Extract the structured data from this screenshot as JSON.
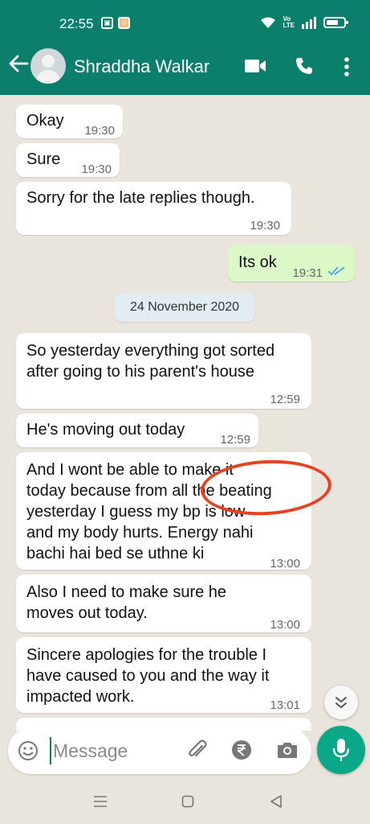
{
  "status_bar": {
    "time": "22:55",
    "notif_icons": [
      "image-icon",
      "avatar-notification-icon"
    ],
    "right_icons": [
      "wifi-icon",
      "volte-icon",
      "signal-icon",
      "battery-icon"
    ]
  },
  "header": {
    "contact_name": "Shraddha Walkar",
    "back_icon": "arrow-left-icon",
    "actions": [
      "video-call-icon",
      "phone-icon",
      "more-vert-icon"
    ],
    "bg_color": "#0b7e6c"
  },
  "messages": [
    {
      "direction": "in",
      "text": "Okay",
      "time": "19:30"
    },
    {
      "direction": "in",
      "text": "Sure",
      "time": "19:30"
    },
    {
      "direction": "in",
      "text": "Sorry for the late replies though.",
      "time": "19:30"
    },
    {
      "direction": "out",
      "text": "Its ok",
      "time": "19:31",
      "status": "read"
    },
    {
      "direction": "in",
      "lines": [
        "So yesterday everything got sorted",
        "after going to his parent's house"
      ],
      "time": "12:59"
    },
    {
      "direction": "in",
      "text": "He's moving out today",
      "time": "12:59"
    },
    {
      "direction": "in",
      "lines": [
        "And I wont be able to make it",
        "today because from all the beating",
        "yesterday I guess my bp is low",
        "and my body hurts. Energy nahi",
        "bachi hai bed se uthne ki"
      ],
      "time": "13:00",
      "annotation": "red-circle-highlight"
    },
    {
      "direction": "in",
      "lines": [
        "Also I need to make sure he",
        "moves out today."
      ],
      "time": "13:00"
    },
    {
      "direction": "in",
      "lines": [
        "Sincere apologies for the trouble I",
        "have caused to you and the way it",
        "impacted work."
      ],
      "time": "13:01"
    }
  ],
  "date_separator": "24 November 2020",
  "composer": {
    "placeholder": "Message",
    "icons": [
      "emoji-icon",
      "attach-icon",
      "rupee-payment-icon",
      "camera-icon"
    ],
    "mic_icon": "microphone-icon"
  },
  "colors": {
    "accent": "#0b7e6c",
    "mic_bg": "#0aa888",
    "out_bubble": "#dcf8c6",
    "in_bubble": "#ffffff",
    "chat_bg": "#e9e4dc",
    "read_tick": "#4fa8e0",
    "annotation": "#e5421f"
  }
}
